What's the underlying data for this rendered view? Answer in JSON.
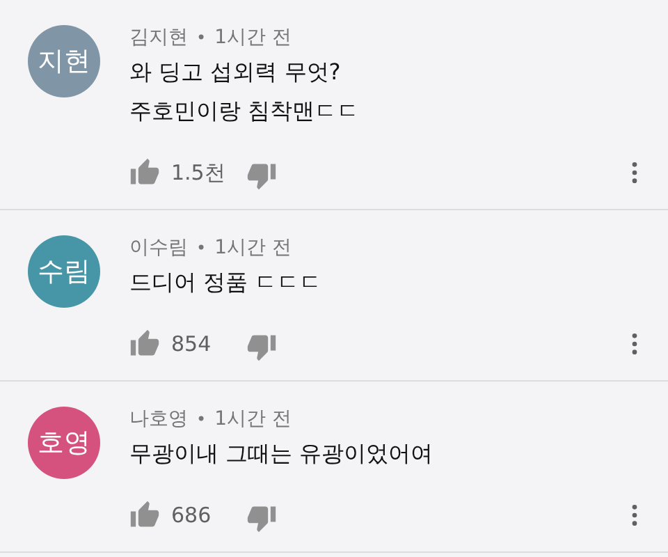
{
  "comments": [
    {
      "avatar": {
        "initials": "지현",
        "color": "#8096a6"
      },
      "author": "김지현",
      "separator": "•",
      "time": "1시간 전",
      "lines": [
        "와 딩고 섭외력 무엇?",
        "주호민이랑 침착맨ㄷㄷ"
      ],
      "likes": "1.5천"
    },
    {
      "avatar": {
        "initials": "수림",
        "color": "#4796a8"
      },
      "author": "이수림",
      "separator": "•",
      "time": "1시간 전",
      "lines": [
        "드디어 정품 ㄷㄷㄷ"
      ],
      "likes": "854"
    },
    {
      "avatar": {
        "initials": "호영",
        "color": "#d5527e"
      },
      "author": "나호영",
      "separator": "•",
      "time": "1시간 전",
      "lines": [
        "무광이내 그때는 유광이었어여"
      ],
      "likes": "686"
    }
  ]
}
